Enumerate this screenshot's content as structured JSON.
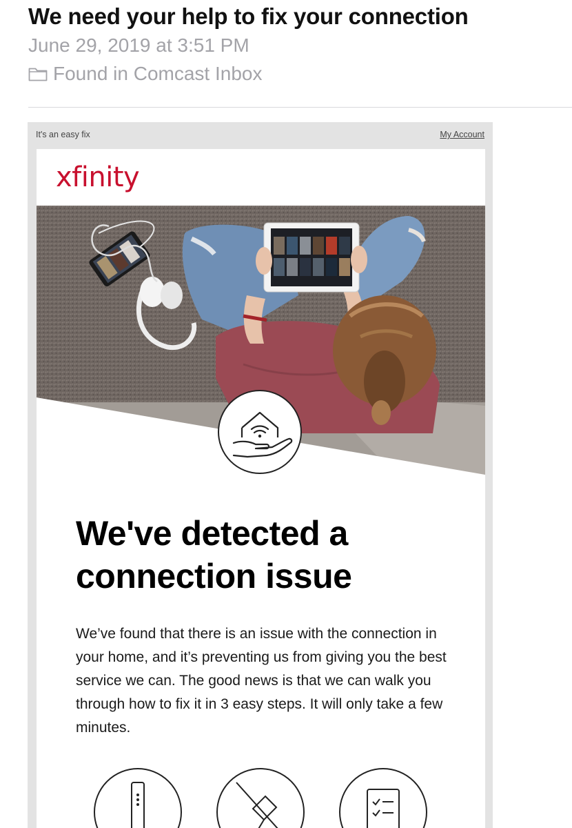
{
  "mail": {
    "subject": "We need your help to fix your connection",
    "date": "June 29, 2019 at 3:51 PM",
    "folder": "Found in Comcast Inbox",
    "folder_icon": "folder-icon"
  },
  "email": {
    "preheader": "It's an easy fix",
    "my_account_link": "My Account",
    "brand": {
      "logo_text": "xfinity",
      "color": "#c8102e"
    },
    "hero_badge_icon": "home-wifi-hand-icon",
    "headline": "We've detected a connection issue",
    "body": "We’ve found that there is an issue with the connection in your home, and it’s preventing us from giving you the best service we can. The good news is that we can walk you through how to fix it in 3 easy steps. It will only take a few minutes.",
    "step_icons": [
      "modem-icon",
      "power-plug-icon",
      "checklist-icon"
    ]
  }
}
